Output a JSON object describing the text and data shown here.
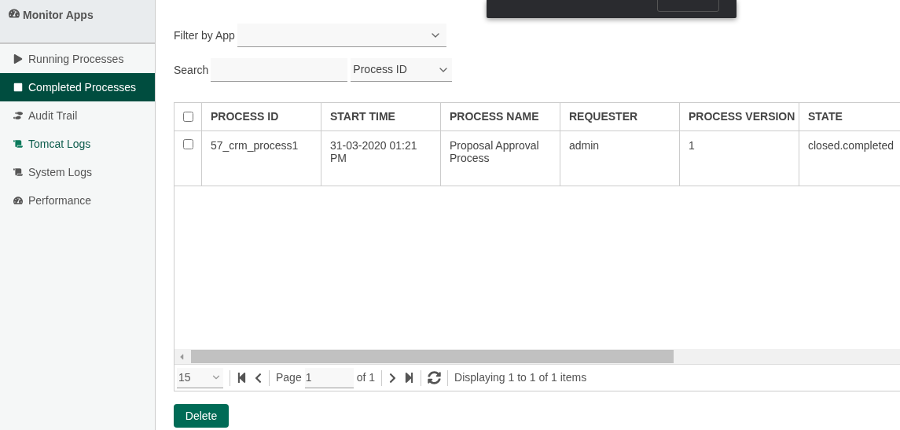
{
  "sidebar": {
    "title": "Monitor Apps",
    "items": [
      {
        "label": "Running Processes",
        "selected": false,
        "highlighted": false
      },
      {
        "label": "Completed Processes",
        "selected": true,
        "highlighted": false
      },
      {
        "label": "Audit Trail",
        "selected": false,
        "highlighted": false
      },
      {
        "label": "Tomcat Logs",
        "selected": false,
        "highlighted": true
      },
      {
        "label": "System Logs",
        "selected": false,
        "highlighted": false
      },
      {
        "label": "Performance",
        "selected": false,
        "highlighted": false
      }
    ]
  },
  "filter": {
    "label": "Filter by App"
  },
  "search": {
    "label": "Search",
    "field": "Process ID"
  },
  "table": {
    "select_all_checked": false,
    "columns": [
      "PROCESS ID",
      "START TIME",
      "PROCESS NAME",
      "REQUESTER",
      "PROCESS VERSION",
      "STATE"
    ],
    "rows": [
      {
        "checked": false,
        "cells": [
          "57_crm_process1",
          "31-03-2020 01:21 PM",
          "Proposal Approval Process",
          "admin",
          "1",
          "closed.completed"
        ]
      }
    ]
  },
  "pager": {
    "page_size": "15",
    "page_label": "Page",
    "page": "1",
    "of": "of 1",
    "info": "Displaying 1 to 1 of 1 items"
  },
  "delete_button": "Delete"
}
